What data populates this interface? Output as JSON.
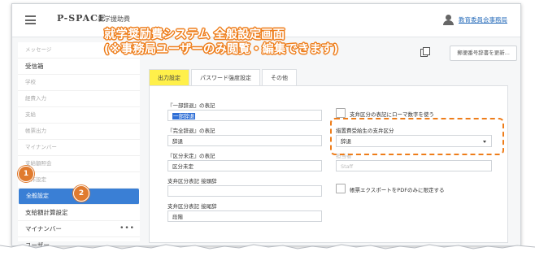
{
  "header": {
    "logo": "P-SPACE",
    "subtitle": "就学援助費",
    "user_icon": "user-icon",
    "user_name": "教育委員会事務局"
  },
  "annotation": {
    "line1": "就学奨励費システム 全般設定画面",
    "line2": "(※事務局ユーザーのみ閲覧・編集できます)"
  },
  "sidebar": {
    "items": [
      {
        "label": "メッセージ"
      },
      {
        "label": "受信箱"
      },
      {
        "label": "学校"
      },
      {
        "label": "経費入力"
      },
      {
        "label": "支給"
      },
      {
        "label": "帳票出力"
      },
      {
        "label": "マイナンバー"
      },
      {
        "label": "支給額照会"
      },
      {
        "label": "動作設定"
      },
      {
        "label": "全般設定"
      },
      {
        "label": "支給額計算設定"
      },
      {
        "label": "マイナンバー"
      },
      {
        "label": "ユーザー"
      }
    ],
    "more_label": "•••"
  },
  "badges": {
    "one": "1",
    "two": "2"
  },
  "toolbar": {
    "copy_icon": "copy-icon",
    "button_label": "郵便番号辞書を更新..."
  },
  "tabs": [
    {
      "label": "出力設定"
    },
    {
      "label": "パスワード強度設定"
    },
    {
      "label": "その他"
    }
  ],
  "form": {
    "field1_label": "『一部辞退』の表記",
    "field1_value": "一部辞退",
    "field2_label": "『完全辞退』の表記",
    "field2_value": "辞退",
    "field3_label": "『区分未定』の表記",
    "field3_value": "区分未定",
    "field4_label": "支弁区分表記 接頭辞",
    "field4_value": "",
    "field5_label": "支弁区分表記 接尾辞",
    "field5_value": "段階",
    "checkbox1_label": "支弁区分の表記にローマ数字を使う",
    "select_label": "措置費受給生の支弁区分",
    "select_value": "辞退",
    "field6_label": "担当者",
    "field6_placeholder": "Staff",
    "checkbox2_label": "帳票エクスポートをPDFのみに限定する"
  },
  "colors": {
    "accent": "#3a7fd5",
    "annotation": "#ee7d1a",
    "tab_highlight": "#fff04a"
  }
}
